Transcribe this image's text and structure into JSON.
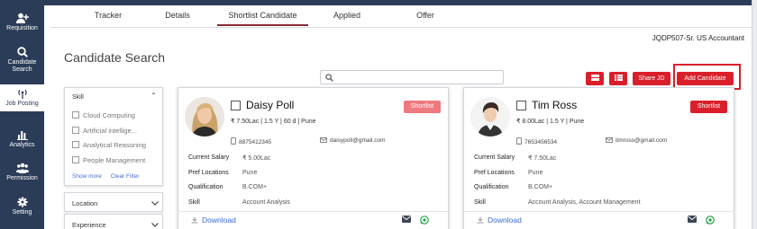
{
  "sidebar": {
    "items": [
      {
        "label": "Requisition",
        "icon": "add-user-icon"
      },
      {
        "label": "Candidate Search",
        "icon": "search-icon"
      },
      {
        "label": "Job Posting",
        "icon": "broadcast-icon"
      },
      {
        "label": "Analytics",
        "icon": "bar-chart-icon"
      },
      {
        "label": "Permission",
        "icon": "users-icon"
      },
      {
        "label": "Setting",
        "icon": "gear-icon"
      }
    ],
    "active": "Job Posting"
  },
  "tabs": [
    {
      "label": "Tracker"
    },
    {
      "label": "Details"
    },
    {
      "label": "Shortlist Candidate"
    },
    {
      "label": "Applied"
    },
    {
      "label": "Offer"
    }
  ],
  "active_tab": "Shortlist Candidate",
  "job_label": "JQDP507-Sr. US Accountant",
  "page_title": "Candidate Search",
  "search": {
    "placeholder": "",
    "value": ""
  },
  "toolbar": {
    "share_label": "Share JD",
    "add_label": "Add Candidate"
  },
  "filters": {
    "skill_title": "Skill",
    "skills": [
      {
        "label": "Cloud Computing",
        "checked": false
      },
      {
        "label": "Artificial intellige...",
        "checked": false
      },
      {
        "label": "Analytical Reasoning",
        "checked": false
      },
      {
        "label": "People Management",
        "checked": false
      }
    ],
    "show_more": "Show more",
    "clear_filter": "Clear Filter",
    "location_title": "Location",
    "experience_title": "Experience"
  },
  "labels": {
    "current_salary": "Current Salary",
    "pref_locations": "Pref Locations",
    "qualification": "Qualification",
    "skill": "Skill",
    "download": "Download"
  },
  "candidates": [
    {
      "name": "Daisy Poll",
      "meta": "₹ 7.50Lac | 1.5 Y | 60 d | Pune",
      "phone": "8875412345",
      "email": "daisypoll@gmail.com",
      "current_salary": "₹ 5.00Lac",
      "pref_locations": "Pune",
      "qualification": "B.COM+",
      "skill": "Account Analysis",
      "shortlist_label": "Shortlist",
      "shortlist_color": "#ee7a7f"
    },
    {
      "name": "Tim Ross",
      "meta": "₹ 8.00Lac | 1.5 Y | Pune",
      "phone": "7653456534",
      "email": "timross@gmail.com",
      "current_salary": "₹ 7.50Lac",
      "pref_locations": "Pune",
      "qualification": "B.COM+",
      "skill": "Account Analysis, Account Management",
      "shortlist_label": "Shortlist",
      "shortlist_color": "#d9202a"
    }
  ],
  "colors": {
    "sidebar": "#2b3c58",
    "accent_red": "#d9202a",
    "link_blue": "#3a6ad0"
  }
}
